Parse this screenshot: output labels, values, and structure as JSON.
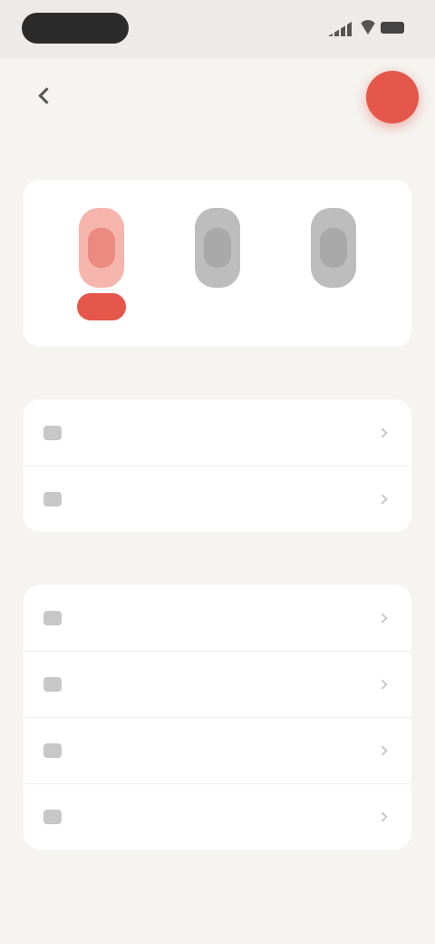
{
  "page": {
    "title": "",
    "fab_label": ""
  },
  "section_appearance": {
    "label": "",
    "options": [
      {
        "label": "",
        "selected": true,
        "check": ""
      },
      {
        "label": "",
        "selected": false
      },
      {
        "label": "",
        "selected": false
      }
    ]
  },
  "section_one": {
    "label": "",
    "rows": [
      {
        "label": "",
        "value": ""
      },
      {
        "label": "",
        "value": ""
      }
    ]
  },
  "section_two": {
    "label": "",
    "rows": [
      {
        "label": "",
        "value": ""
      },
      {
        "label": "",
        "value": ""
      },
      {
        "label": "",
        "value": ""
      },
      {
        "label": "",
        "value": ""
      }
    ]
  },
  "colors": {
    "accent": "#e4574a",
    "background": "#f5f4f1",
    "card": "#ffffff"
  },
  "icons": {
    "back": "chevron-left-icon",
    "fab": "circle-action-icon",
    "row": "list-row-icon"
  }
}
